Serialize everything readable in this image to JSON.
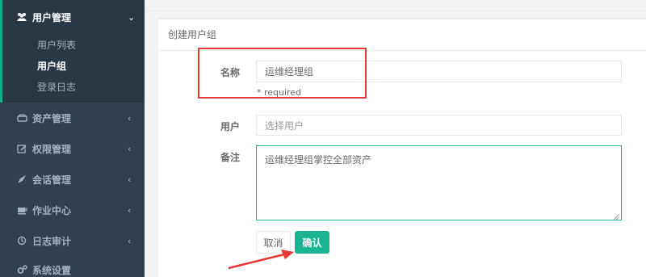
{
  "sidebar": {
    "top": {
      "icon": "users-icon",
      "label": "用户管理"
    },
    "sub_items": [
      {
        "label": "用户列表",
        "active": false
      },
      {
        "label": "用户组",
        "active": true
      },
      {
        "label": "登录日志",
        "active": false
      }
    ],
    "items": [
      {
        "icon": "hdd-icon",
        "label": "资产管理"
      },
      {
        "icon": "edit-icon",
        "label": "权限管理"
      },
      {
        "icon": "rocket-icon",
        "label": "会话管理"
      },
      {
        "icon": "coffee-icon",
        "label": "作业中心"
      },
      {
        "icon": "history-icon",
        "label": "日志审计"
      },
      {
        "icon": "cogs-icon",
        "label": "系统设置"
      }
    ]
  },
  "panel": {
    "title": "创建用户组",
    "name_label": "名称",
    "name_value": "运维经理组",
    "name_help": "* required",
    "users_label": "用户",
    "users_placeholder": "选择用户",
    "comment_label": "备注",
    "comment_value": "运维经理组掌控全部资产",
    "cancel_label": "取消",
    "confirm_label": "确认"
  },
  "colors": {
    "sidebar_bg": "#2f4050",
    "accent": "#1ab394",
    "annotation": "#e53935"
  }
}
